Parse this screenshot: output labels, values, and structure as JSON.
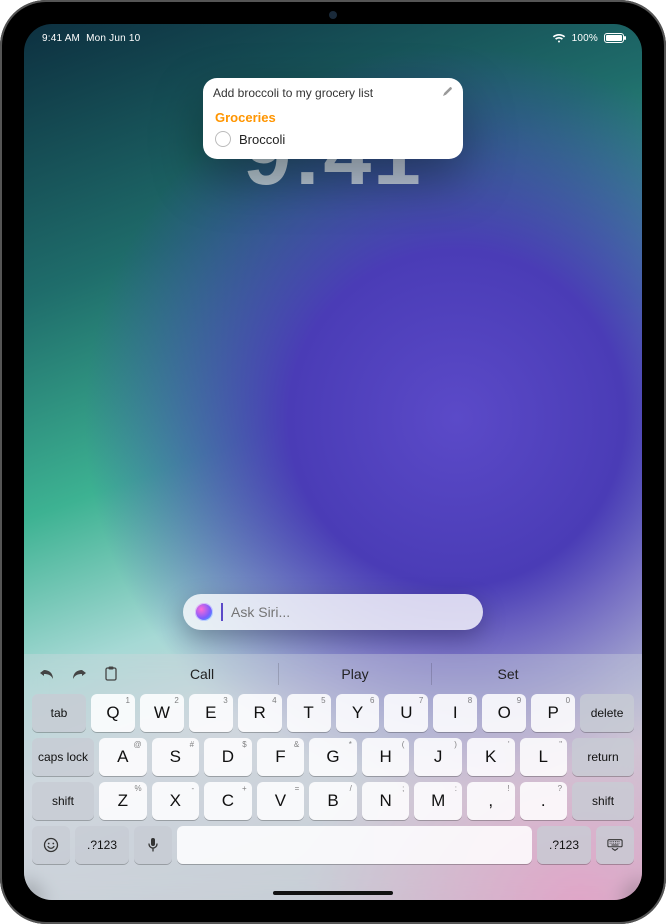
{
  "status": {
    "time": "9:41 AM",
    "date_label": "Mon Jun 10",
    "battery_percent": "100%"
  },
  "lock_screen": {
    "time_display": "9:41"
  },
  "siri_card": {
    "request_text": "Add broccoli to my grocery list",
    "list_title": "Groceries",
    "item_label": "Broccoli"
  },
  "siri_input": {
    "placeholder": "Ask Siri..."
  },
  "keyboard": {
    "suggests": [
      "Call",
      "Play",
      "Set"
    ],
    "numrow_sub": [
      "1",
      "2",
      "3",
      "4",
      "5",
      "6",
      "7",
      "8",
      "9",
      "0"
    ],
    "row1": [
      "Q",
      "W",
      "E",
      "R",
      "T",
      "Y",
      "U",
      "I",
      "O",
      "P"
    ],
    "row2_sub": [
      "@",
      "#",
      "$",
      "&",
      "*",
      "(",
      ")",
      "'",
      "\""
    ],
    "row2": [
      "A",
      "S",
      "D",
      "F",
      "G",
      "H",
      "J",
      "K",
      "L"
    ],
    "row3_sub": [
      "%",
      "-",
      "+",
      "=",
      "/",
      ";",
      ":",
      "!",
      "?"
    ],
    "row3": [
      "Z",
      "X",
      "C",
      "V",
      "B",
      "N",
      "M",
      ",",
      "."
    ],
    "tab_label": "tab",
    "delete_label": "delete",
    "caps_label": "caps lock",
    "return_label": "return",
    "shift_label": "shift",
    "numpad_label": ".?123"
  }
}
